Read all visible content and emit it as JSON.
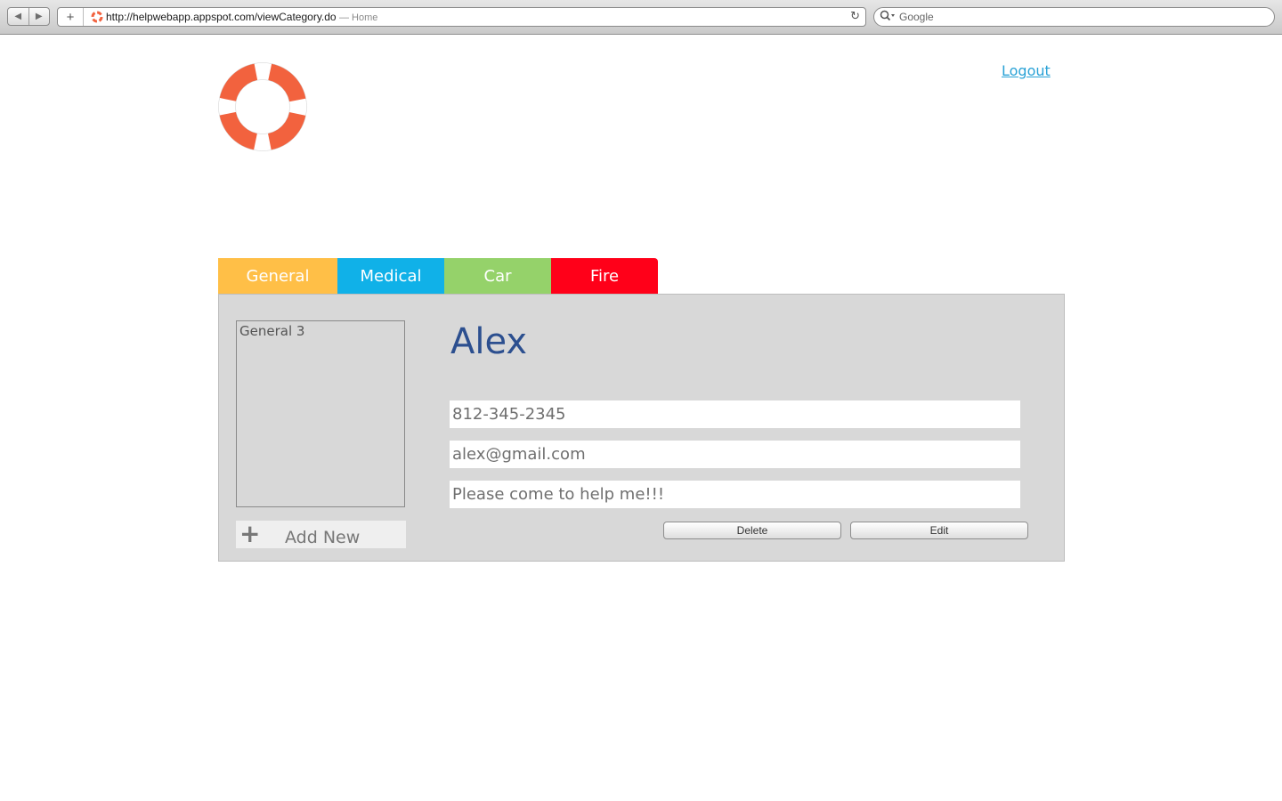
{
  "browser": {
    "url": "http://helpwebapp.appspot.com/viewCategory.do",
    "page_title": "— Home",
    "search_placeholder": "Google",
    "back_icon": "◀",
    "forward_icon": "▶",
    "add_icon": "+",
    "reload_icon": "↻"
  },
  "header": {
    "logout_label": "Logout",
    "logo_colors": {
      "primary": "#f2623e",
      "secondary": "#ffffff"
    }
  },
  "tabs": [
    {
      "label": "General",
      "color": "#ffbf47"
    },
    {
      "label": "Medical",
      "color": "#10b1e8"
    },
    {
      "label": "Car",
      "color": "#95d26a"
    },
    {
      "label": "Fire",
      "color": "#ff0019"
    }
  ],
  "sidebar": {
    "items": [
      {
        "label": "General 3"
      }
    ],
    "add_new_label": "Add New",
    "add_new_icon": "+"
  },
  "contact": {
    "name": "Alex",
    "phone": "812-345-2345",
    "email": "alex@gmail.com",
    "message": "Please come to help me!!!"
  },
  "actions": {
    "delete_label": "Delete",
    "edit_label": "Edit"
  }
}
